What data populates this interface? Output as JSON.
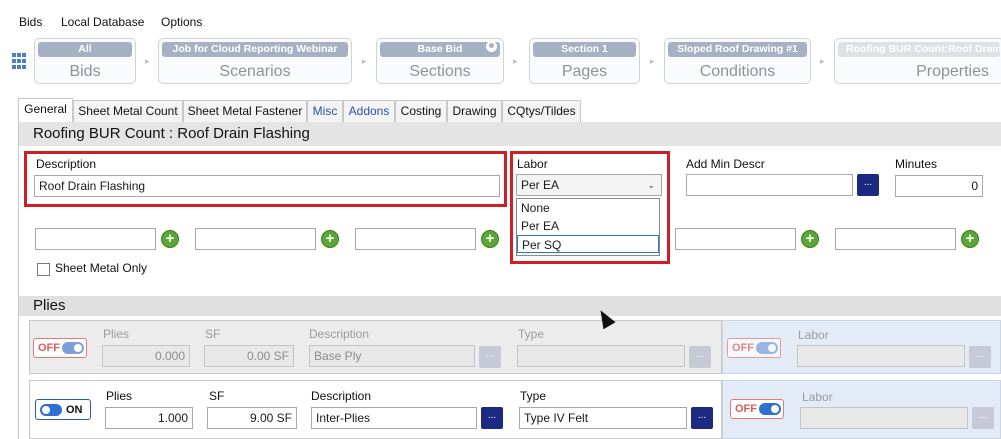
{
  "menu": {
    "bids": "Bids",
    "local_database": "Local Database",
    "options": "Options"
  },
  "breadcrumb": [
    {
      "top": "All",
      "bottom": "Bids"
    },
    {
      "top": "Job for Cloud Reporting Webinar",
      "bottom": "Scenarios"
    },
    {
      "top": "Base Bid",
      "bottom": "Sections"
    },
    {
      "top": "Section 1",
      "bottom": "Pages"
    },
    {
      "top": "Sloped Roof Drawing #1",
      "bottom": "Conditions"
    },
    {
      "top": "Roofing BUR Count:Roof Drain Flashing",
      "bottom": "Properties"
    }
  ],
  "tabs": [
    "General",
    "Sheet Metal Count",
    "Sheet Metal Fastener",
    "Misc",
    "Addons",
    "Costing",
    "Drawing",
    "CQtys/Tildes"
  ],
  "panel_title": "Roofing BUR Count : Roof Drain Flashing",
  "general": {
    "description_label": "Description",
    "description_value": "Roof Drain Flashing",
    "labor_label": "Labor",
    "labor_selected": "Per EA",
    "labor_options": [
      "None",
      "Per EA",
      "Per SQ"
    ],
    "add_min_descr_label": "Add Min Descr",
    "add_min_descr_value": "",
    "ellipsis": "...",
    "minutes_label": "Minutes",
    "minutes_value": "0",
    "sheet_metal_only_label": "Sheet Metal Only",
    "plus": "+"
  },
  "plies_title": "Plies",
  "plies_rows": [
    {
      "toggle": "OFF",
      "plies_label": "Plies",
      "plies": "0.000",
      "sf_label": "SF",
      "sf": "0.00 SF",
      "description_label": "Description",
      "description": "Base Ply",
      "type_label": "Type",
      "type": "",
      "labor_toggle": "OFF",
      "labor_label": "Labor"
    },
    {
      "toggle": "ON",
      "plies_label": "Plies",
      "plies": "1.000",
      "sf_label": "SF",
      "sf": "9.00 SF",
      "description_label": "Description",
      "description": "Inter-Plies",
      "type_label": "Type",
      "type": "Type IV Felt",
      "labor_toggle": "OFF",
      "labor_label": "Labor"
    }
  ],
  "colors": {
    "accent_red": "#cf1f25",
    "button_navy": "#1b2a80",
    "plus_green": "#5aa636",
    "toggle_blue": "#2f6fd0"
  }
}
